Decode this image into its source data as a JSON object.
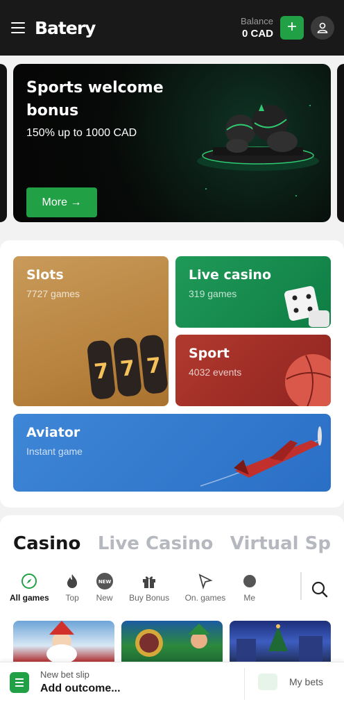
{
  "header": {
    "logo": "Batery",
    "balance_label": "Balance",
    "balance_value": "0 CAD",
    "add_label": "+"
  },
  "promo": {
    "title": "Sports welcome bonus",
    "subtitle": "150% up to 1000 CAD",
    "button": "More →"
  },
  "tiles": {
    "slots": {
      "title": "Slots",
      "sub": "7727 games"
    },
    "live_casino": {
      "title": "Live casino",
      "sub": "319 games"
    },
    "sport": {
      "title": "Sport",
      "sub": "4032 events"
    },
    "aviator": {
      "title": "Aviator",
      "sub": "Instant game"
    }
  },
  "casino": {
    "tabs": [
      {
        "label": "Casino"
      },
      {
        "label": "Live Casino"
      },
      {
        "label": "Virtual Sp"
      }
    ],
    "filters": [
      {
        "label": "All games",
        "icon": "compass-icon"
      },
      {
        "label": "Top",
        "icon": "flame-icon"
      },
      {
        "label": "New",
        "icon": "new-badge-icon"
      },
      {
        "label": "Buy Bonus",
        "icon": "gift-icon"
      },
      {
        "label": "On. games",
        "icon": "sparkle-icon"
      },
      {
        "label": "Me",
        "icon": "more-icon"
      }
    ]
  },
  "bottom_bar": {
    "slip_label": "New bet slip",
    "slip_value": "Add outcome...",
    "my_bets": "My bets"
  },
  "colors": {
    "accent": "#21a046",
    "header_bg": "#191919",
    "slots": "#c0904e",
    "live_casino": "#189050",
    "sport": "#a32d27",
    "aviator": "#3579cf"
  }
}
